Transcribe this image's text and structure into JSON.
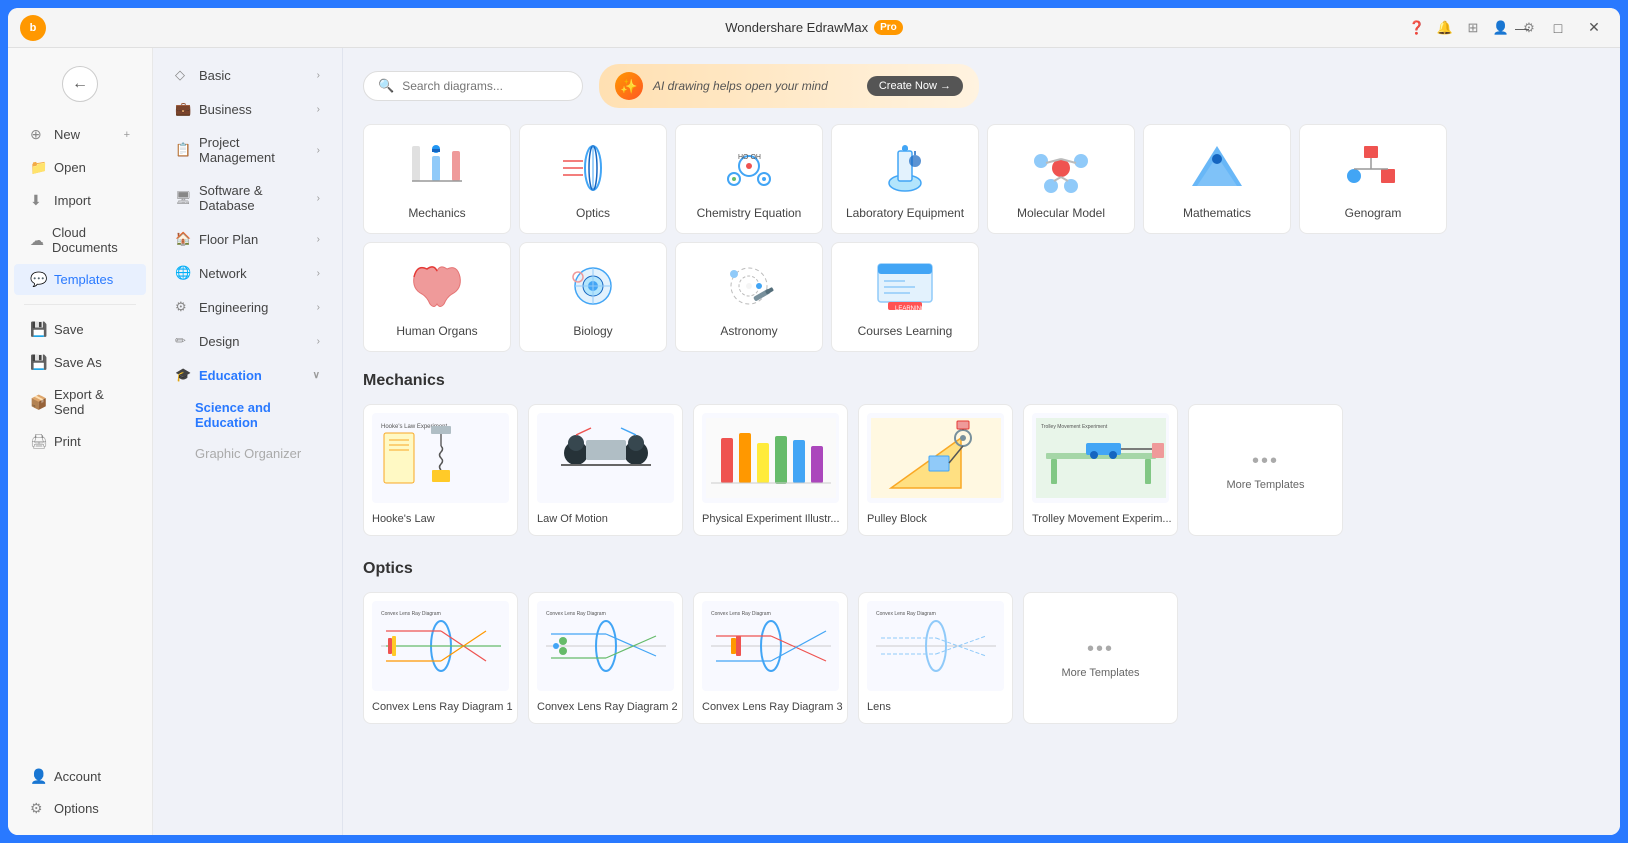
{
  "app": {
    "title": "Wondershare EdrawMax",
    "pro_badge": "Pro",
    "user_initial": "b"
  },
  "titlebar": {
    "minimize": "—",
    "maximize": "□",
    "close": "✕"
  },
  "search": {
    "placeholder": "Search diagrams..."
  },
  "ai_banner": {
    "text": "AI drawing helps open your mind",
    "create_label": "Create Now →"
  },
  "nav": {
    "back_label": "←",
    "items": [
      {
        "id": "new",
        "label": "New",
        "icon": "⊕"
      },
      {
        "id": "open",
        "label": "Open",
        "icon": "📁"
      },
      {
        "id": "import",
        "label": "Import",
        "icon": "⬇"
      },
      {
        "id": "cloud",
        "label": "Cloud Documents",
        "icon": "☁"
      },
      {
        "id": "templates",
        "label": "Templates",
        "icon": "💬"
      },
      {
        "id": "save",
        "label": "Save",
        "icon": "💾"
      },
      {
        "id": "save-as",
        "label": "Save As",
        "icon": "💾"
      },
      {
        "id": "export",
        "label": "Export & Send",
        "icon": "📦"
      },
      {
        "id": "print",
        "label": "Print",
        "icon": "🖨"
      }
    ],
    "bottom": [
      {
        "id": "account",
        "label": "Account",
        "icon": "👤"
      },
      {
        "id": "options",
        "label": "Options",
        "icon": "⚙"
      }
    ]
  },
  "sidebar": {
    "menu_items": [
      {
        "id": "basic",
        "label": "Basic",
        "icon": "◇",
        "has_sub": true
      },
      {
        "id": "business",
        "label": "Business",
        "icon": "💼",
        "has_sub": true
      },
      {
        "id": "project",
        "label": "Project Management",
        "icon": "📋",
        "has_sub": true
      },
      {
        "id": "software",
        "label": "Software & Database",
        "icon": "🖥",
        "has_sub": true
      },
      {
        "id": "floor",
        "label": "Floor Plan",
        "icon": "🏠",
        "has_sub": true
      },
      {
        "id": "network",
        "label": "Network",
        "icon": "🌐",
        "has_sub": true
      },
      {
        "id": "engineering",
        "label": "Engineering",
        "icon": "⚙",
        "has_sub": true
      },
      {
        "id": "design",
        "label": "Design",
        "icon": "✏",
        "has_sub": true
      },
      {
        "id": "education",
        "label": "Education",
        "icon": "🎓",
        "active": true,
        "has_sub": false
      }
    ],
    "sub_items": [
      {
        "id": "science",
        "label": "Science and Education",
        "active": true
      },
      {
        "id": "graphic",
        "label": "Graphic Organizer",
        "dim": true
      }
    ]
  },
  "categories": [
    {
      "id": "mechanics",
      "label": "Mechanics"
    },
    {
      "id": "optics",
      "label": "Optics"
    },
    {
      "id": "chemistry",
      "label": "Chemistry Equation"
    },
    {
      "id": "lab",
      "label": "Laboratory Equipment"
    },
    {
      "id": "molecular",
      "label": "Molecular Model"
    },
    {
      "id": "math",
      "label": "Mathematics"
    },
    {
      "id": "genogram",
      "label": "Genogram"
    },
    {
      "id": "organs",
      "label": "Human Organs"
    },
    {
      "id": "biology",
      "label": "Biology"
    },
    {
      "id": "astronomy",
      "label": "Astronomy"
    },
    {
      "id": "courses",
      "label": "Courses Learning"
    }
  ],
  "sections": [
    {
      "id": "mechanics",
      "title": "Mechanics",
      "templates": [
        {
          "id": "hookes",
          "label": "Hooke's Law"
        },
        {
          "id": "lawmotion",
          "label": "Law Of Motion"
        },
        {
          "id": "physexp",
          "label": "Physical Experiment Illustr..."
        },
        {
          "id": "pulley",
          "label": "Pulley Block"
        },
        {
          "id": "trolley",
          "label": "Trolley Movement Experim..."
        }
      ]
    },
    {
      "id": "optics",
      "title": "Optics",
      "templates": [
        {
          "id": "convex1",
          "label": "Convex Lens Ray Diagram 1"
        },
        {
          "id": "convex2",
          "label": "Convex Lens Ray Diagram 2"
        },
        {
          "id": "convex3",
          "label": "Convex Lens Ray Diagram 3"
        },
        {
          "id": "lens",
          "label": "Lens"
        }
      ]
    }
  ],
  "more_templates_label": "More Templates"
}
